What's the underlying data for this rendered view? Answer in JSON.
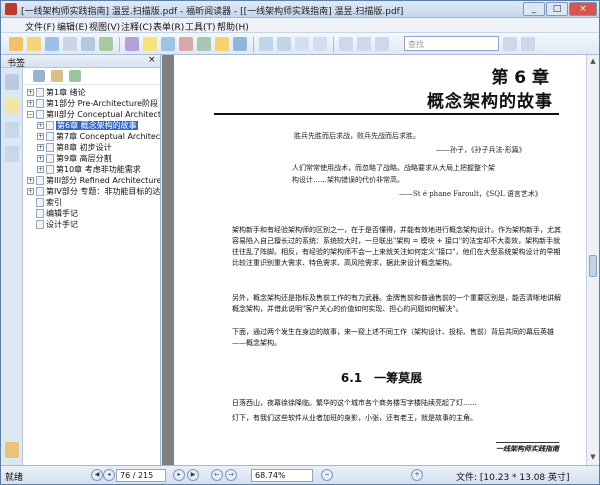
{
  "window": {
    "title": "[一线架构师实践指南] 温昱.扫描版.pdf - 福昕阅读器 - [[一线架构师实践指南] 温昱.扫描版.pdf]"
  },
  "menu": [
    "文件(F)",
    "编辑(E)",
    "视图(V)",
    "注释(C)",
    "表单(R)",
    "工具(T)",
    "帮助(H)"
  ],
  "toolbar": {
    "search_placeholder": "查找",
    "icons": [
      "hand-icon",
      "select-icon",
      "snapshot-icon",
      "pen-icon",
      "note-icon",
      "zoom-in-icon",
      "zoom-out-icon"
    ]
  },
  "panel": {
    "title": "书签",
    "close": "×"
  },
  "bookmarks": [
    {
      "pm": "+",
      "label": "第1章  绪论"
    },
    {
      "pm": "+",
      "label": "第1部分  Pre-Architecture阶段"
    },
    {
      "pm": "−",
      "label": "第II部分  Conceptual Architecture"
    },
    {
      "pm": "+",
      "label": "第6章  概念架构的故事",
      "selected": true
    },
    {
      "pm": "+",
      "label": "第7章  Conceptual Architecture"
    },
    {
      "pm": "+",
      "label": "第8章  初步设计"
    },
    {
      "pm": "+",
      "label": "第9章  高层分割"
    },
    {
      "pm": "+",
      "label": "第10章  考虑非功能需求"
    },
    {
      "pm": "+",
      "label": "第III部分  Refined Architecture"
    },
    {
      "pm": "+",
      "label": "第IV部分  专题：非功能目标的达成"
    },
    {
      "pm": "",
      "label": "索引"
    },
    {
      "pm": "",
      "label": "编辑手记"
    },
    {
      "pm": "",
      "label": "设计手记"
    }
  ],
  "page": {
    "chapter_num": "第 6 章",
    "chapter_title": "概念架构的故事",
    "quote1": "胜兵先胜而后求战，败兵先战而后求胜。",
    "quote1_src": "——孙子，《孙子兵法·形篇》",
    "quote2a": "人们常常使用战术，而忽略了战略。战略要求从大局上把握整个架",
    "quote2b": "构设计……架构错误的代价非常高。",
    "quote2_src": "——St é phane Faroult，《SQL 语言艺术》",
    "para1": "架构新手和有经验架构师的区别之一，在于是否懂得，并能有效地进行概念架构设计。作为架构新手，尤其容易陷入自己擅长过的系统：系统较大时，一旦联出\"架构 = 模块 + 接口\"的法宝却不大奏效，架构新手就往往乱了阵脚。相反，有经验的架构师不会一上来就关注如何定义\"接口\"，他们在大型系统架构设计的早期比较注重识别重大需求、特色需求、高风险需求，据此来设计概念架构。",
    "para2": "另外，概念架构还是指标及售前工作的有力武器。金牌售前和普通售前的一个重要区别是，能否清晰地讲解概念架构，并借此说明\"客户关心的价值如何实现、担心的问题如何解决\"。",
    "para3": "下面，通过两个发生在身边的故事，来一窥上述不同工作（架构设计、投标、售前）背后共同的幕后英雄——概念架构。",
    "section": "6.1　一筹莫展",
    "para4": "日落西山，夜幕徐徐降临。繁华的这个城市各个商务楼写字楼陆续亮起了灯……",
    "para5": "灯下，有我们这些软件从业者加班的身影，小张，还有老王，就是故事的主角。",
    "footer": "一线架构师实践指南"
  },
  "status": {
    "ready": "就绪",
    "page": "76 / 215",
    "zoom": "68.74%",
    "file_info": "文件: [10.23 * 13.08 英寸]"
  }
}
